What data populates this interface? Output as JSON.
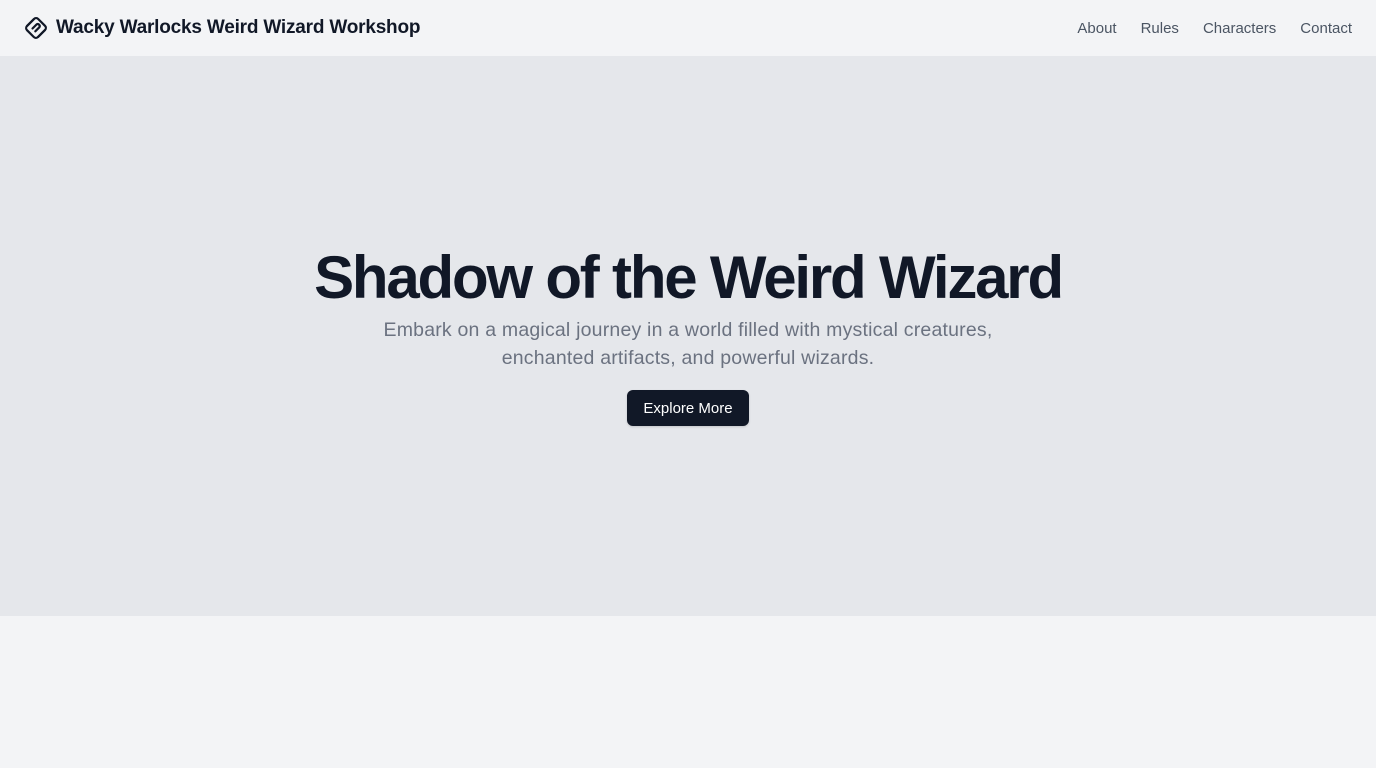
{
  "header": {
    "brand_name": "Wacky Warlocks Weird Wizard Workshop",
    "brand_icon": "linked-loop-logo-icon",
    "nav": [
      {
        "label": "About"
      },
      {
        "label": "Rules"
      },
      {
        "label": "Characters"
      },
      {
        "label": "Contact"
      }
    ]
  },
  "hero": {
    "title": "Shadow of the Weird Wizard",
    "subtitle": "Embark on a magical journey in a world filled with mystical creatures, enchanted artifacts, and powerful wizards.",
    "cta_label": "Explore More"
  },
  "colors": {
    "page_background": "#f3f4f6",
    "hero_background": "#e5e7eb",
    "primary_text": "#111827",
    "muted_text": "#6b7280",
    "button_background": "#111827",
    "button_text": "#ffffff"
  }
}
